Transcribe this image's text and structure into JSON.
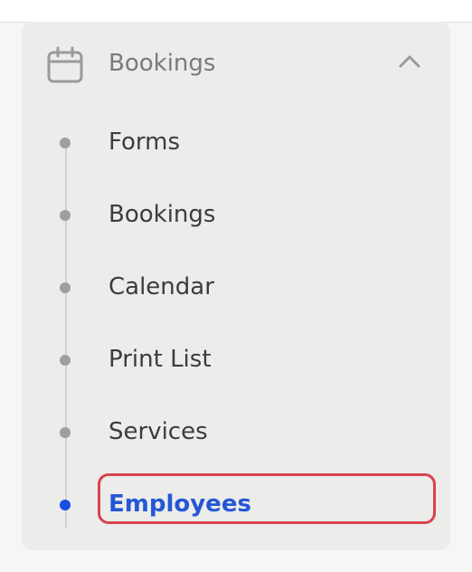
{
  "menu": {
    "header": {
      "label": "Bookings",
      "icon": "calendar-icon",
      "expanded": true,
      "toggle_icon": "chevron-up-icon"
    },
    "items": [
      {
        "label": "Forms",
        "active": false
      },
      {
        "label": "Bookings",
        "active": false
      },
      {
        "label": "Calendar",
        "active": false
      },
      {
        "label": "Print List",
        "active": false
      },
      {
        "label": "Services",
        "active": false
      },
      {
        "label": "Employees",
        "active": true
      }
    ]
  },
  "colors": {
    "active_text": "#2457d6",
    "active_dot": "#1a4fe0",
    "inactive_dot": "#9e9e9e",
    "highlight_border": "#d9434e",
    "group_background": "#ececea"
  }
}
